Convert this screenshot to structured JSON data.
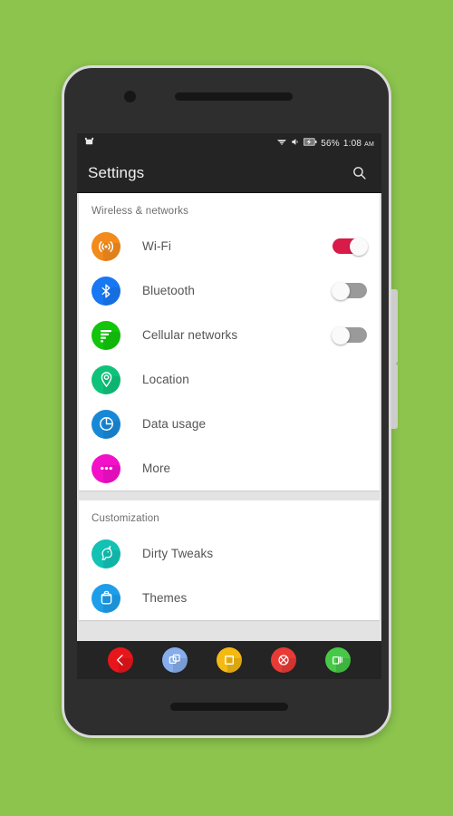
{
  "wallpaper_color": "#8CC44E",
  "status_bar": {
    "notification_icon": "android-robot-icon",
    "wifi_icon": "wifi-signal-icon",
    "volume_icon": "volume-icon",
    "battery_icon": "battery-charging-icon",
    "battery_percent": "56%",
    "time": "1:08",
    "ampm": "AM"
  },
  "action_bar": {
    "title": "Settings",
    "search_icon": "search-icon"
  },
  "sections": [
    {
      "header": "Wireless & networks",
      "rows": [
        {
          "label": "Wi-Fi",
          "icon": "wifi-icon",
          "icon_color": "#F28A1C",
          "toggle": "on"
        },
        {
          "label": "Bluetooth",
          "icon": "bluetooth-icon",
          "icon_color": "#1877F2",
          "toggle": "off"
        },
        {
          "label": "Cellular networks",
          "icon": "signal-bars-icon",
          "icon_color": "#12C40B",
          "toggle": "off"
        },
        {
          "label": "Location",
          "icon": "map-pin-icon",
          "icon_color": "#0FC27A",
          "toggle": "none"
        },
        {
          "label": "Data usage",
          "icon": "pie-clock-icon",
          "icon_color": "#1888D6",
          "toggle": "none"
        },
        {
          "label": "More",
          "icon": "more-dots-icon",
          "icon_color": "#F210C8",
          "toggle": "none"
        }
      ]
    },
    {
      "header": "Customization",
      "rows": [
        {
          "label": "Dirty Tweaks",
          "icon": "unicorn-icon",
          "icon_color": "#12C2B4",
          "toggle": "none"
        },
        {
          "label": "Themes",
          "icon": "paint-bucket-icon",
          "icon_color": "#1E9EE8",
          "toggle": "none"
        }
      ]
    }
  ],
  "nav_bar": {
    "buttons": [
      {
        "name": "back-button",
        "icon": "chevron-left-icon",
        "color": "#E8161B"
      },
      {
        "name": "multi-window-button",
        "icon": "stacked-squares-icon",
        "color": "#86AEEC"
      },
      {
        "name": "home-button",
        "icon": "square-icon",
        "color": "#F5B914"
      },
      {
        "name": "kill-app-button",
        "icon": "circle-x-icon",
        "color": "#EA3A36"
      },
      {
        "name": "recents-button",
        "icon": "recents-icon",
        "color": "#46C947"
      }
    ]
  },
  "toggle_colors": {
    "on": "#d81b48",
    "off": "#9a9a9a"
  }
}
